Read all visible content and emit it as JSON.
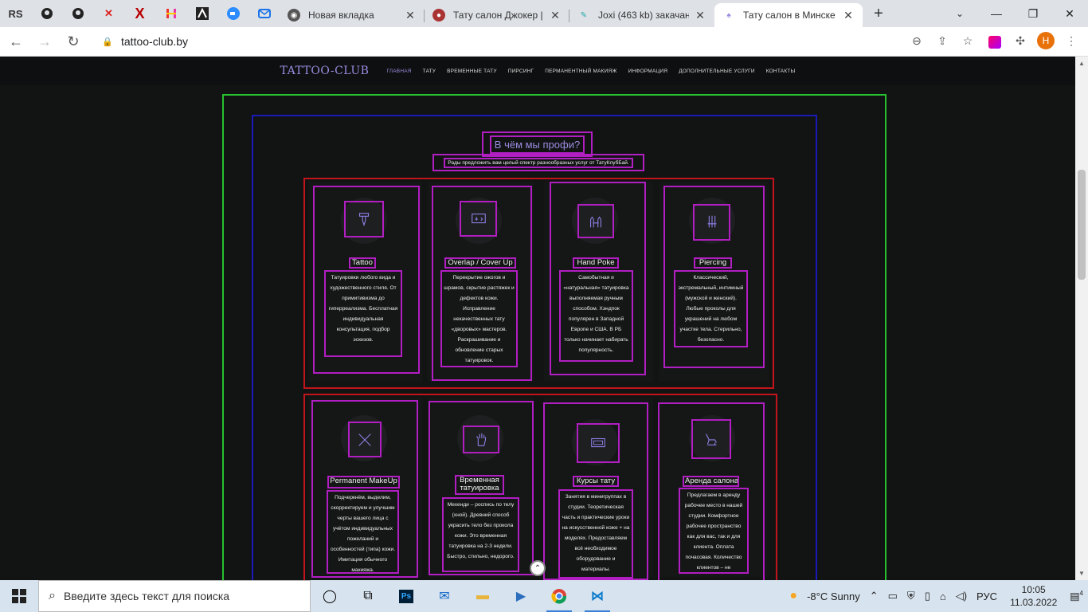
{
  "browser": {
    "pinned": [
      "RS",
      "github",
      "github",
      "bookmark-red",
      "X",
      "H",
      "A",
      "zoom",
      "mail"
    ],
    "tabs": [
      {
        "title": "Новая вкладка",
        "icon": "chrome-icon"
      },
      {
        "title": "Тату салон Джокер | с",
        "icon": "site-icon"
      },
      {
        "title": "Joxi (463 kb) закачан",
        "icon": "joxi-icon"
      },
      {
        "title": "Тату салон в Минске",
        "icon": "tattoo-icon",
        "active": true
      }
    ],
    "url": "tattoo-club.by",
    "profile_initial": "H"
  },
  "site": {
    "logo": "TATTOO-CLUB",
    "nav": [
      "ГЛАВНАЯ",
      "ТАТУ",
      "ВРЕМЕННЫЕ ТАТУ",
      "ПИРСИНГ",
      "ПЕРМАНЕНТНЫЙ МАКИЯЖ",
      "ИНФОРМАЦИЯ",
      "ДОПОЛНИТЕЛЬНЫЕ УСЛУГИ",
      "КОНТАКТЫ"
    ],
    "heading": "В чём мы профи?",
    "subtitle": "Рады предложить вам целый спектр разнообразных услуг от ТатуКлубБай.",
    "services": [
      {
        "title": "Tattoo",
        "desc": "Татуировки любого вида и художественного стиля. От примитивизма до гиперреализма. Бесплатная индивидуальная консультация, подбор эскизов.",
        "icon": "tattoo-machine-icon"
      },
      {
        "title": "Overlap / Cover Up",
        "desc": "Перекрытие ожогов и шрамов, скрытие растяжек и дефектов кожи. Исправление некачественных тату «дворовых» мастеров. Раскрашивание и обновление старых татуировок.",
        "icon": "cover-up-icon"
      },
      {
        "title": "Hand Poke",
        "desc": "Самобытная и «натуральная» татуировка выполняемая ручным способом. Хэндпок популярен в Западной Европе и США. В РБ только начинает набирать популярность.",
        "icon": "hands-icon"
      },
      {
        "title": "Piercing",
        "desc": "Классический, экстремальный, интимный (мужской и женский). Любые проколы для украшений на любом участке тела. Стерильно, безопасно.",
        "icon": "piercing-icon"
      },
      {
        "title": "Permanent MakeUp",
        "desc": "Подчеркнём, выделим, скорректируем и улучшим черты вашего лица с учётом индивидуальных пожеланий и особенностей (типа) кожи. Имитация обычного макияжа.",
        "icon": "makeup-tools-icon"
      },
      {
        "title": "Временная татуировка",
        "desc": "Мехенди – роспись по телу (хной). Древний способ украсить тело без прокола кожи. Это временная татуировка на 2-3 недели. Быстро, стильно, недорого.",
        "icon": "henna-hand-icon"
      },
      {
        "title": "Курсы тату",
        "desc": "Занятия в минигруппах в студии. Теоретическая часть и практические уроки на искусственной коже + на моделях. Предоставляем всё необходимое оборудование и материалы.",
        "icon": "course-screen-icon"
      },
      {
        "title": "Аренда салона",
        "desc": "Предлагаем в аренду рабочее место в нашей студии. Комфортное рабочее пространство как для вас, так и для клиента. Оплата почасовая. Количество клиентов – не ограничено.",
        "icon": "tattoo-chair-icon"
      }
    ]
  },
  "taskbar": {
    "search_placeholder": "Введите здесь текст для поиска",
    "weather": "-8°C  Sunny",
    "lang": "РУС",
    "time": "10:05",
    "date": "11.03.2022",
    "notifications": "4"
  },
  "colors": {
    "accent": "#9b8be0",
    "debug_magenta": "#b11ec2",
    "debug_red": "#c3141c",
    "debug_blue": "#1a1ab8",
    "debug_green": "#27c12f"
  }
}
